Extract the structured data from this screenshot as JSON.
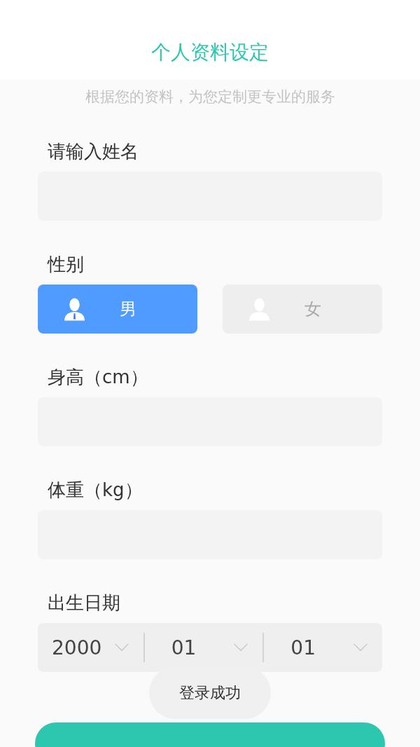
{
  "header": {
    "title": "个人资料设定"
  },
  "subtitle": "根据您的资料，为您定制更专业的服务",
  "name_field": {
    "label": "请输入姓名"
  },
  "gender": {
    "label": "性别",
    "options": [
      {
        "label": "男",
        "selected": true,
        "kind": "male"
      },
      {
        "label": "女",
        "selected": false,
        "kind": "female"
      }
    ]
  },
  "height_field": {
    "label": "身高（cm）"
  },
  "weight_field": {
    "label": "体重（kg）"
  },
  "birth_date": {
    "label": "出生日期",
    "parts": [
      {
        "value": "2000"
      },
      {
        "value": "01"
      },
      {
        "value": "01"
      }
    ]
  },
  "toast": "登录成功"
}
